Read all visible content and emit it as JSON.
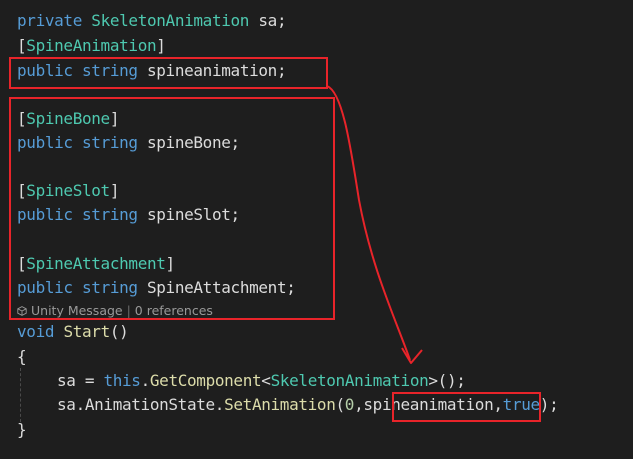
{
  "code": {
    "line1": {
      "kw1": "private",
      "type": "SkeletonAnimation",
      "rest": " sa;"
    },
    "line2": {
      "open": "[",
      "attr": "SpineAnimation",
      "close": "]"
    },
    "line3": {
      "kw1": "public",
      "kw2": "string",
      "rest": " spineanimation;"
    },
    "line4": {
      "open": "[",
      "attr": "SpineBone",
      "close": "]"
    },
    "line5": {
      "kw1": "public",
      "kw2": "string",
      "rest": " spineBone;"
    },
    "line6": {
      "open": "[",
      "attr": "SpineSlot",
      "close": "]"
    },
    "line7": {
      "kw1": "public",
      "kw2": "string",
      "rest": " spineSlot;"
    },
    "line8": {
      "open": "[",
      "attr": "SpineAttachment",
      "close": "]"
    },
    "line9": {
      "kw1": "public",
      "kw2": "string",
      "rest": " SpineAttachment;"
    },
    "codelens": {
      "label": "Unity Message",
      "separator": " | ",
      "refs": "0 references",
      "icon": "unity-cube-icon"
    },
    "line10": {
      "kw1": "void",
      "method": "Start",
      "parens": "()"
    },
    "line11": {
      "text": "{"
    },
    "line12": {
      "var": "sa",
      "eq": " = ",
      "kw": "this",
      "dot": ".",
      "method": "GetComponent",
      "lt": "<",
      "type": "SkeletonAnimation",
      "gt": ">();"
    },
    "line13": {
      "var": "sa.AnimationState.",
      "method": "SetAnimation",
      "open": "(",
      "num": "0",
      "comma": ",",
      "arg": "spineanimation",
      "comma2": ",",
      "kw": "true",
      "close": ");"
    },
    "line14": {
      "text": "}"
    }
  },
  "colors": {
    "background": "#1e1e1e",
    "keyword": "#569cd6",
    "type": "#4ec9b0",
    "method": "#dcdcaa",
    "plain": "#dcdcdc",
    "number": "#b5cea8",
    "annotation": "#e8242a"
  }
}
